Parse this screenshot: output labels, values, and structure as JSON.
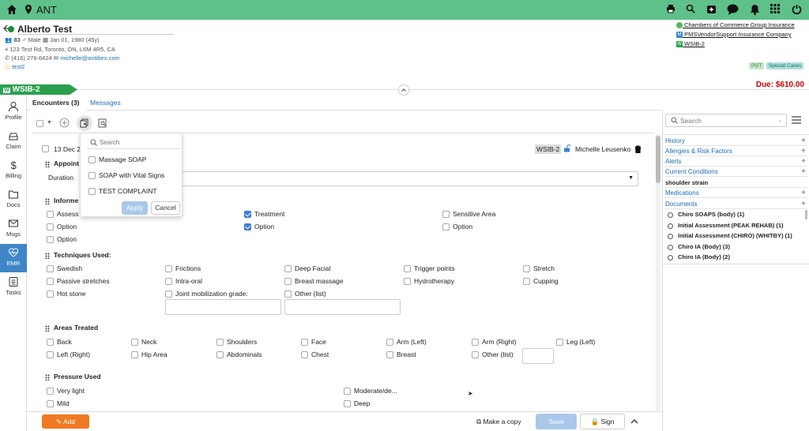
{
  "app": {
    "title": "ANT"
  },
  "patient": {
    "name": "Alberto Test",
    "id": "83",
    "gender": "Male",
    "dob": "Jan 01, 1980 (45y)",
    "address": "123 Test Rd, Toronto, ON, L6M 4R5, CA",
    "phone": "(416) 276-6424",
    "email": "michelle@antibex.com",
    "tag": "test2"
  },
  "insurance": [
    {
      "label": "Chambers of Commerce Group Insurance",
      "color": "#5cb85c",
      "glyph": ""
    },
    {
      "label": "PMSVendorSupport Insurance Company",
      "color": "#3e86c7",
      "glyph": "M"
    },
    {
      "label": "WSIB-2",
      "color": "#2aa04e",
      "glyph": "W"
    }
  ],
  "badges": {
    "pgt": "PGT",
    "special": "Special Cases"
  },
  "case": {
    "icon": "W",
    "label": "WSIB-2",
    "due": "Due: $610.00"
  },
  "sidebar": [
    {
      "label": "Profile",
      "icon": "person-icon"
    },
    {
      "label": "Claim",
      "icon": "car-icon"
    },
    {
      "label": "Billing",
      "icon": "dollar-icon"
    },
    {
      "label": "Docs",
      "icon": "folder-icon"
    },
    {
      "label": "Msgs",
      "icon": "mail-icon"
    },
    {
      "label": "EMR",
      "icon": "heart-icon"
    },
    {
      "label": "Tasks",
      "icon": "list-icon"
    }
  ],
  "tabs": {
    "encounters": "Encounters (3)",
    "messages": "Messages"
  },
  "encounter": {
    "date": "13 Dec 2",
    "case": "WSIB-2",
    "provider": "Michelle Leusenko"
  },
  "dropdown": {
    "search_placeholder": "Search",
    "items": [
      "Massage SOAP",
      "SOAP with Vital Signs",
      "TEST COMPLAINT"
    ],
    "apply": "Apply",
    "cancel": "Cancel"
  },
  "form": {
    "appointment": {
      "title": "Appoint",
      "duration": "Duration"
    },
    "informed": {
      "title": "Informe",
      "options": [
        {
          "label": "Assess",
          "checked": false
        },
        {
          "label": "Treatment",
          "checked": true
        },
        {
          "label": "Sensitive Area",
          "checked": false
        },
        {
          "label": "Option",
          "checked": false
        },
        {
          "label": "Option",
          "checked": true
        },
        {
          "label": "Option",
          "checked": false
        },
        {
          "label": "Option",
          "checked": false
        }
      ]
    },
    "techniques": {
      "title": "Techniques Used:",
      "options": [
        "Swedish",
        "Frictions",
        "Deep Facial",
        "Trigger points",
        "Stretch",
        "Passive stretches",
        "Intra-oral",
        "Breast massage",
        "Hydrotherapy",
        "Cupping",
        "Hot stone",
        "Joint mobilization grade:",
        "Other (list)"
      ]
    },
    "areas": {
      "title": "Areas Treated",
      "options": [
        "Back",
        "Neck",
        "Shoulders",
        "Face",
        "Arm (Left)",
        "Arm (Right)",
        "Leg (Left)",
        "Left (Right)",
        "Hip Area",
        "Abdominals",
        "Chest",
        "Breast",
        "Other (list)"
      ]
    },
    "pressure": {
      "title": "Pressure Used",
      "options": [
        "Very light",
        "Moderate/de...",
        "Mild",
        "Deep"
      ]
    }
  },
  "footer": {
    "add": "Add",
    "copy": "Make a copy",
    "save": "Save",
    "sign": "Sign"
  },
  "right": {
    "search_placeholder": "Search",
    "sections": [
      "History",
      "Allergies & Risk Factors",
      "Alerts",
      "Current Conditions"
    ],
    "condition": "shoulder strain",
    "sections2": [
      "Medications",
      "Documents"
    ],
    "documents": [
      "Chiro SOAPS (body) (1)",
      "Initial Assessment (PEAK REHAB) (1)",
      "Initial Assessment (CHIRO) (WHITBY) (1)",
      "Chiro IA (Body) (3)",
      "Chiro IA (Body) (2)"
    ]
  }
}
